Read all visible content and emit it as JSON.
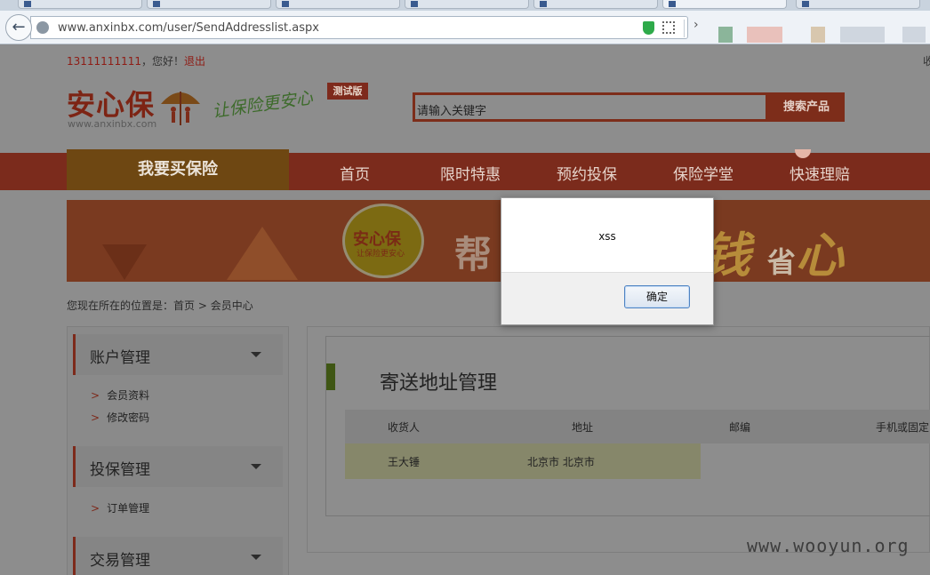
{
  "browser": {
    "url": "www.anxinbx.com/user/SendAddresslist.aspx"
  },
  "header": {
    "user_phone": "13111111111",
    "greeting": "，您好！",
    "logout": "退出",
    "top_right_fragment": "收",
    "logo_text": "安心保",
    "logo_url": "www.anxinbx.com",
    "slogan": "让保险更安心",
    "beta_badge": "测试版",
    "search_placeholder": "请输入关键字",
    "search_button": "搜索产品"
  },
  "nav": {
    "buy_label": "我要买保险",
    "items": [
      "首页",
      "限时特惠",
      "预约投保",
      "保险学堂",
      "快速理赔"
    ]
  },
  "banner": {
    "circle_title": "安心保",
    "circle_sub": "让保险更安心",
    "text_left": "帮",
    "text_right_a": "钱",
    "text_right_b": "省",
    "text_right_c": "心"
  },
  "breadcrumb": {
    "prefix": "您现在所在的位置是：",
    "home": "首页",
    "sep": ">",
    "current": "会员中心"
  },
  "sidebar": {
    "sections": [
      {
        "title": "账户管理",
        "links": [
          "会员资料",
          "修改密码"
        ]
      },
      {
        "title": "投保管理",
        "links": [
          "订单管理"
        ]
      },
      {
        "title": "交易管理",
        "links": []
      }
    ],
    "arrow": ">"
  },
  "content": {
    "title": "寄送地址管理",
    "columns": [
      "收货人",
      "地址",
      "邮编",
      "手机或固定"
    ],
    "rows": [
      {
        "recipient": "王大锤",
        "address": "北京市 北京市",
        "zip": "",
        "phone": ""
      }
    ]
  },
  "dialog": {
    "message": "xss",
    "ok_label": "确定"
  },
  "watermark": "www.wooyun.org"
}
